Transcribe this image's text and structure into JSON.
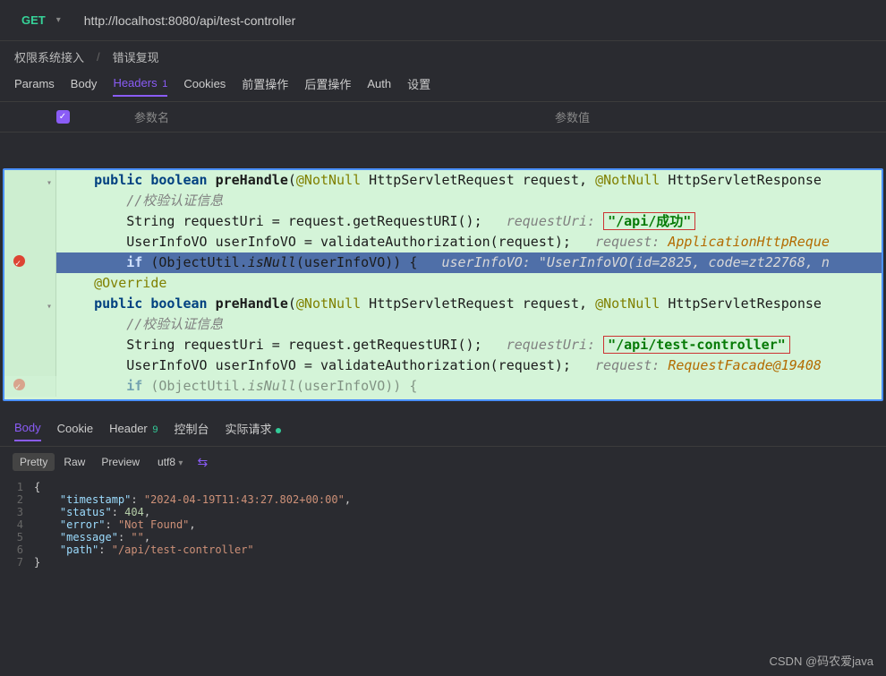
{
  "request": {
    "method": "GET",
    "url": "http://localhost:8080/api/test-controller"
  },
  "breadcrumbs": {
    "b1": "权限系统接入",
    "b2": "错误复现"
  },
  "reqTabs": {
    "params": "Params",
    "body": "Body",
    "headers": "Headers",
    "headersBadge": "1",
    "cookies": "Cookies",
    "pre": "前置操作",
    "post": "后置操作",
    "auth": "Auth",
    "settings": "设置"
  },
  "headerGrid": {
    "name": "参数名",
    "value": "参数值"
  },
  "respTabs": {
    "body": "Body",
    "cookie": "Cookie",
    "header": "Header",
    "headerBadge": "9",
    "console": "控制台",
    "actual": "实际请求"
  },
  "fmt": {
    "pretty": "Pretty",
    "raw": "Raw",
    "preview": "Preview",
    "enc": "utf8"
  },
  "jsonResp": {
    "l1": "{",
    "l2k": "\"timestamp\"",
    "l2v": "\"2024-04-19T11:43:27.802+00:00\"",
    "l3k": "\"status\"",
    "l3v": "404",
    "l4k": "\"error\"",
    "l4v": "\"Not Found\"",
    "l5k": "\"message\"",
    "l5v": "\"\"",
    "l6k": "\"path\"",
    "l6v": "\"/api/test-controller\"",
    "l7": "}"
  },
  "code": {
    "a1_pre": "public boolean ",
    "a1_fn": "preHandle",
    "a1_post": "(@NotNull HttpServletRequest request, @NotNull HttpServletResponse",
    "a2": "//校验认证信息",
    "a3_pre": "String requestUri = request.getRequestURI();   ",
    "a3_hint": "requestUri: ",
    "a3_box": "\"/api/成功\"",
    "a4_pre": "UserInfoVO userInfoVO = validateAuthorization(request);   ",
    "a4_hint": "request: ",
    "a4_val": "ApplicationHttpReque",
    "a5_code": "if (ObjectUtil.isNull(userInfoVO)) {   ",
    "a5_hint": "userInfoVO: \"UserInfoVO(id=2825, code=zt22768, n",
    "b0": "@Override",
    "b1_pre": "public boolean ",
    "b1_fn": "preHandle",
    "b1_post": "(@NotNull HttpServletRequest request, @NotNull HttpServletResponse",
    "b2": "//校验认证信息",
    "b3_pre": "String requestUri = request.getRequestURI();   ",
    "b3_hint": "requestUri: ",
    "b3_box": "\"/api/test-controller\"",
    "b4_pre": "UserInfoVO userInfoVO = validateAuthorization(request);   ",
    "b4_hint": "request: ",
    "b4_val": "RequestFacade@19408",
    "b5": "if (ObjectUtil.isNull(userInfoVO)) {"
  },
  "watermark": "CSDN @码农爱java"
}
